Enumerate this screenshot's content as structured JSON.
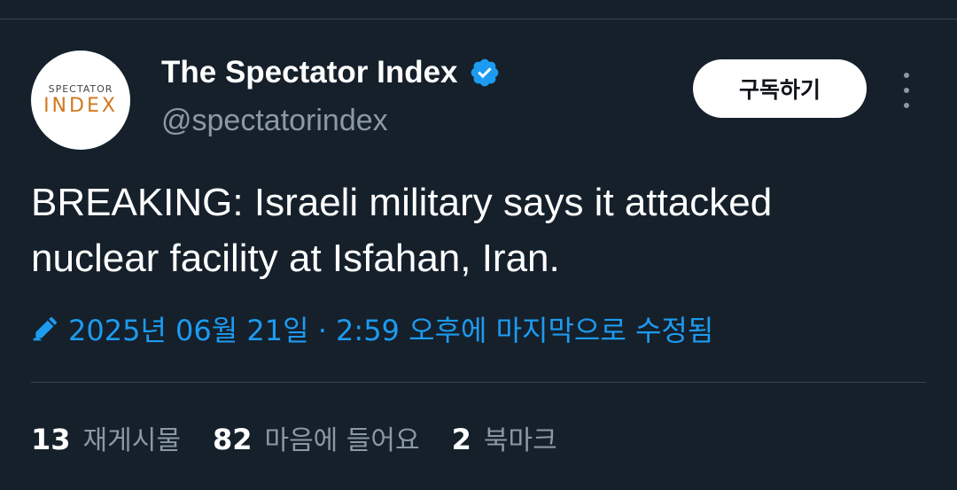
{
  "author": {
    "display_name": "The Spectator Index",
    "handle": "@spectatorindex",
    "avatar_text_top": "SPECTATOR",
    "avatar_text_bottom": "INDEX",
    "verified_icon": "verified-badge-icon"
  },
  "actions": {
    "subscribe_label": "구독하기",
    "more_icon": "more-options-icon"
  },
  "tweet": {
    "text": "BREAKING: Israeli military says it attacked\nnuclear facility at Isfahan, Iran.",
    "edited_label": "2025년 06월 21일 · 2:59 오후에 마지막으로 수정됨",
    "edit_icon": "pencil-icon"
  },
  "stats": [
    {
      "count": "13",
      "label": "재게시물"
    },
    {
      "count": "82",
      "label": "마음에 들어요"
    },
    {
      "count": "2",
      "label": "북마크"
    }
  ],
  "colors": {
    "background": "#15202b",
    "accent": "#1d9bf0",
    "muted": "#8b98a5",
    "divider": "#38444d",
    "avatar_brand": "#d1791e"
  }
}
